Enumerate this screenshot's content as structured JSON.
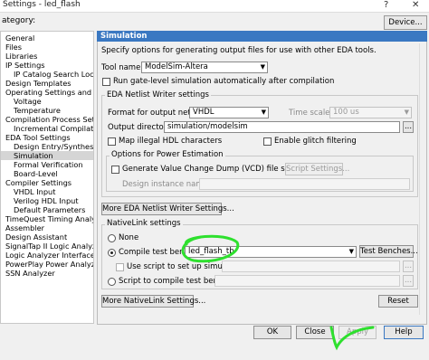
{
  "window": {
    "title": "Settings - led_flash",
    "help_icon": "?",
    "close_icon": "✕"
  },
  "category_label": "ategory:",
  "device_button": "Device...",
  "tree": [
    "General",
    "Files",
    "Libraries",
    "IP Settings",
    "IP Catalog Search Loca",
    "Design Templates",
    "Operating Settings and Cor",
    "Voltage",
    "Temperature",
    "Compilation Process Settin",
    "Incremental Compilation",
    "EDA Tool Settings",
    "Design Entry/Synthesis",
    "Simulation",
    "Formal Verification",
    "Board-Level",
    "Compiler Settings",
    "VHDL Input",
    "Verilog HDL Input",
    "Default Parameters",
    "TimeQuest Timing Analyze",
    "Assembler",
    "Design Assistant",
    "SignalTap II Logic Analyze",
    "Logic Analyzer Interface",
    "PowerPlay Power Analyzer",
    "SSN Analyzer"
  ],
  "tree_selected": "Simulation",
  "panel": {
    "title": "Simulation",
    "description": "Specify options for generating output files for use with other EDA tools.",
    "tool_name_label": "Tool name:",
    "tool_name_value": "ModelSim-Altera",
    "run_gate_level_label": "Run gate-level simulation automatically after compilation",
    "eda_netlist_group": "EDA Netlist Writer settings",
    "format_label": "Format for output netlist:",
    "format_value": "VHDL",
    "time_scale_label": "Time scale:",
    "time_scale_value": "100 us",
    "output_dir_label": "Output directory:",
    "output_dir_value": "simulation/modelsim",
    "browse": "...",
    "map_illegal_label": "Map illegal HDL characters",
    "enable_glitch_label": "Enable glitch filtering",
    "power_group": "Options for Power Estimation",
    "vcd_label": "Generate Value Change Dump (VCD) file script",
    "script_settings": "Script Settings...",
    "design_instance_label": "Design instance name:",
    "more_eda_button": "More EDA Netlist Writer Settings...",
    "nativelink_group": "NativeLink settings",
    "none_label": "None",
    "compile_tb_label": "Compile test bench:",
    "compile_tb_value": "led_flash_tb",
    "test_benches_button": "Test Benches...",
    "use_script_label": "Use script to set up simulation:",
    "script_compile_label": "Script to compile test bench:",
    "more_nativelink_button": "More NativeLink Settings...",
    "reset_button": "Reset"
  },
  "footer": {
    "ok": "OK",
    "close": "Close",
    "apply": "Apply",
    "help": "Help"
  },
  "colors": {
    "panel_header": "#3a78c2",
    "annotation": "#2ee02e"
  }
}
